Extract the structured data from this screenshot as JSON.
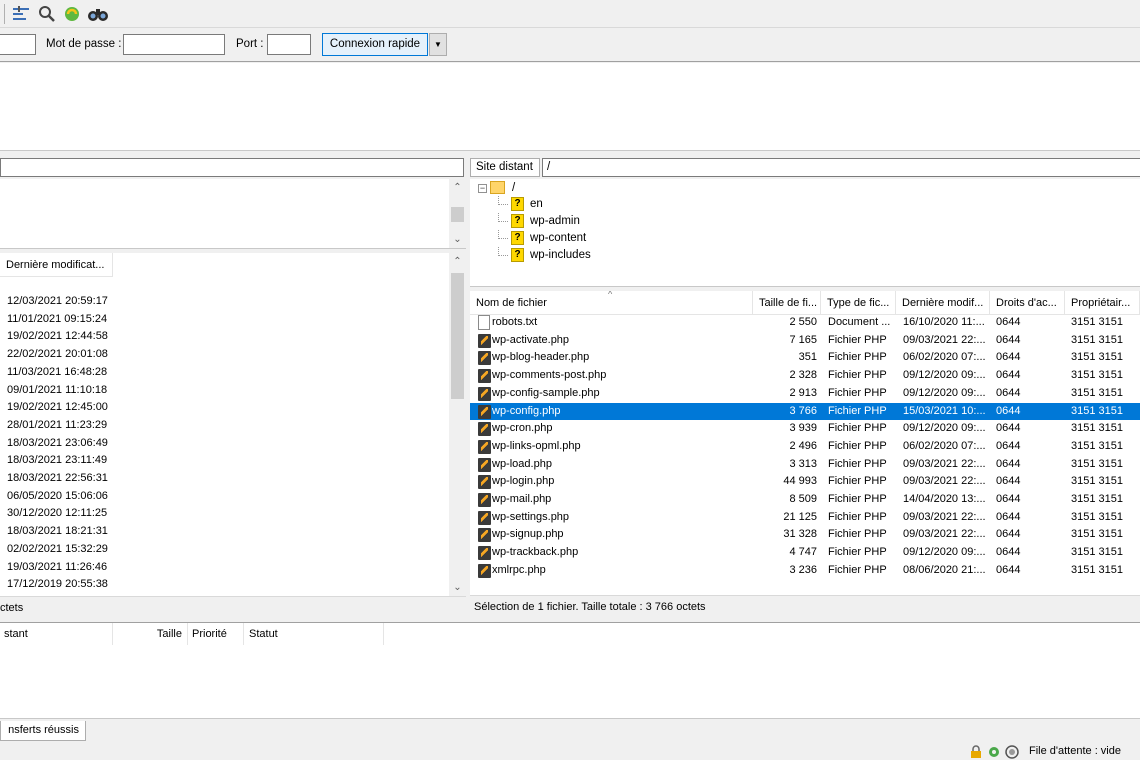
{
  "quickconnect": {
    "password_label": "Mot de passe :",
    "port_label": "Port :",
    "connect_label": "Connexion rapide",
    "dropdown_glyph": "▼"
  },
  "local": {
    "column_modified": "Dernière modificat...",
    "dates": [
      "12/03/2021 20:59:17",
      "11/01/2021 09:15:24",
      "19/02/2021 12:44:58",
      "22/02/2021 20:01:08",
      "11/03/2021 16:48:28",
      "09/01/2021 11:10:18",
      "19/02/2021 12:45:00",
      "28/01/2021 11:23:29",
      "18/03/2021 23:06:49",
      "18/03/2021 23:11:49",
      "18/03/2021 22:56:31",
      "06/05/2020 15:06:06",
      "30/12/2020 12:11:25",
      "18/03/2021 18:21:31",
      "02/02/2021 15:32:29",
      "19/03/2021 11:26:46",
      "17/12/2019 20:55:38"
    ],
    "status_text": "ctets"
  },
  "remote": {
    "site_label": "Site distant :",
    "path_value": "/",
    "tree_root": "/",
    "tree_children": [
      "en",
      "wp-admin",
      "wp-content",
      "wp-includes"
    ],
    "columns": {
      "name": "Nom de fichier",
      "size": "Taille de fi...",
      "type": "Type de fic...",
      "modified": "Dernière modif...",
      "perms": "Droits d'ac...",
      "owner": "Propriétair..."
    },
    "files": [
      {
        "name": "robots.txt",
        "size": "2 550",
        "type": "Document ...",
        "modified": "16/10/2020 11:...",
        "perms": "0644",
        "owner": "3151 3151",
        "icon": "text-file-icon"
      },
      {
        "name": "wp-activate.php",
        "size": "7 165",
        "type": "Fichier PHP",
        "modified": "09/03/2021 22:...",
        "perms": "0644",
        "owner": "3151 3151",
        "icon": "php-file-icon"
      },
      {
        "name": "wp-blog-header.php",
        "size": "351",
        "type": "Fichier PHP",
        "modified": "06/02/2020 07:...",
        "perms": "0644",
        "owner": "3151 3151",
        "icon": "php-file-icon"
      },
      {
        "name": "wp-comments-post.php",
        "size": "2 328",
        "type": "Fichier PHP",
        "modified": "09/12/2020 09:...",
        "perms": "0644",
        "owner": "3151 3151",
        "icon": "php-file-icon"
      },
      {
        "name": "wp-config-sample.php",
        "size": "2 913",
        "type": "Fichier PHP",
        "modified": "09/12/2020 09:...",
        "perms": "0644",
        "owner": "3151 3151",
        "icon": "php-file-icon"
      },
      {
        "name": "wp-config.php",
        "size": "3 766",
        "type": "Fichier PHP",
        "modified": "15/03/2021 10:...",
        "perms": "0644",
        "owner": "3151 3151",
        "icon": "php-file-icon",
        "selected": true
      },
      {
        "name": "wp-cron.php",
        "size": "3 939",
        "type": "Fichier PHP",
        "modified": "09/12/2020 09:...",
        "perms": "0644",
        "owner": "3151 3151",
        "icon": "php-file-icon"
      },
      {
        "name": "wp-links-opml.php",
        "size": "2 496",
        "type": "Fichier PHP",
        "modified": "06/02/2020 07:...",
        "perms": "0644",
        "owner": "3151 3151",
        "icon": "php-file-icon"
      },
      {
        "name": "wp-load.php",
        "size": "3 313",
        "type": "Fichier PHP",
        "modified": "09/03/2021 22:...",
        "perms": "0644",
        "owner": "3151 3151",
        "icon": "php-file-icon"
      },
      {
        "name": "wp-login.php",
        "size": "44 993",
        "type": "Fichier PHP",
        "modified": "09/03/2021 22:...",
        "perms": "0644",
        "owner": "3151 3151",
        "icon": "php-file-icon"
      },
      {
        "name": "wp-mail.php",
        "size": "8 509",
        "type": "Fichier PHP",
        "modified": "14/04/2020 13:...",
        "perms": "0644",
        "owner": "3151 3151",
        "icon": "php-file-icon"
      },
      {
        "name": "wp-settings.php",
        "size": "21 125",
        "type": "Fichier PHP",
        "modified": "09/03/2021 22:...",
        "perms": "0644",
        "owner": "3151 3151",
        "icon": "php-file-icon"
      },
      {
        "name": "wp-signup.php",
        "size": "31 328",
        "type": "Fichier PHP",
        "modified": "09/03/2021 22:...",
        "perms": "0644",
        "owner": "3151 3151",
        "icon": "php-file-icon"
      },
      {
        "name": "wp-trackback.php",
        "size": "4 747",
        "type": "Fichier PHP",
        "modified": "09/12/2020 09:...",
        "perms": "0644",
        "owner": "3151 3151",
        "icon": "php-file-icon"
      },
      {
        "name": "xmlrpc.php",
        "size": "3 236",
        "type": "Fichier PHP",
        "modified": "08/06/2020 21:...",
        "perms": "0644",
        "owner": "3151 3151",
        "icon": "php-file-icon"
      }
    ],
    "status_text": "Sélection de 1 fichier. Taille totale : 3 766 octets"
  },
  "queue": {
    "col_remote": "stant",
    "col_size": "Taille",
    "col_priority": "Priorité",
    "col_status": "Statut"
  },
  "tabs": {
    "success": "nsferts réussis"
  },
  "statusbar": {
    "queue_text": "File d'attente : vide"
  },
  "colors": {
    "selection": "#0078d7",
    "folder": "#ffd56a",
    "unknown_folder": "#ffd800"
  }
}
